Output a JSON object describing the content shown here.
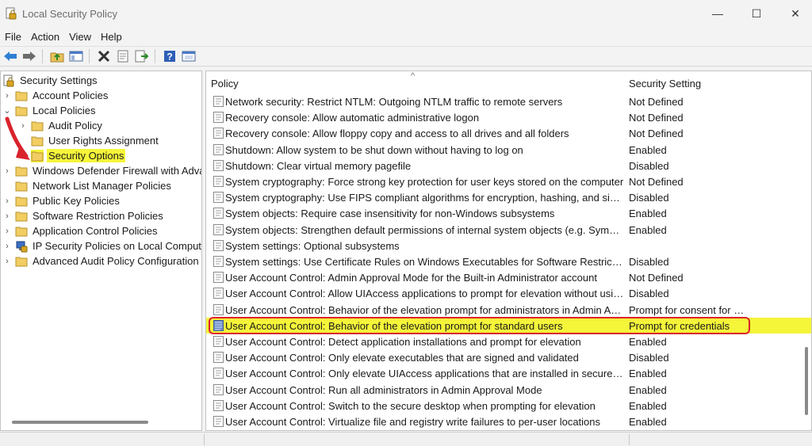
{
  "window": {
    "title": "Local Security Policy",
    "controls": {
      "minimize": "—",
      "maximize": "☐",
      "close": "✕"
    }
  },
  "menu": [
    "File",
    "Action",
    "View",
    "Help"
  ],
  "toolbar": {
    "buttons": [
      "back-icon",
      "forward-icon",
      "up-folder-icon",
      "show-hide-tree-icon",
      "delete-icon",
      "properties-icon",
      "export-list-icon",
      "help-icon",
      "console-icon"
    ]
  },
  "tree": {
    "items": [
      {
        "label": "Security Settings",
        "icon": "security-settings-icon",
        "expander": ""
      },
      {
        "label": "Account Policies",
        "icon": "folder-icon",
        "expander": "›"
      },
      {
        "label": "Local Policies",
        "icon": "folder-icon",
        "expander": "⌄"
      },
      {
        "label": "Audit Policy",
        "icon": "folder-icon",
        "expander": "›"
      },
      {
        "label": "User Rights Assignment",
        "icon": "folder-icon",
        "expander": ""
      },
      {
        "label": "Security Options",
        "icon": "folder-icon",
        "expander": "",
        "selected": true
      },
      {
        "label": "Windows Defender Firewall with Advan",
        "icon": "folder-icon",
        "expander": "›"
      },
      {
        "label": "Network List Manager Policies",
        "icon": "folder-icon",
        "expander": ""
      },
      {
        "label": "Public Key Policies",
        "icon": "folder-icon",
        "expander": "›"
      },
      {
        "label": "Software Restriction Policies",
        "icon": "folder-icon",
        "expander": "›"
      },
      {
        "label": "Application Control Policies",
        "icon": "folder-icon",
        "expander": "›"
      },
      {
        "label": "IP Security Policies on Local Computer",
        "icon": "ip-security-icon",
        "expander": "›"
      },
      {
        "label": "Advanced Audit Policy Configuration",
        "icon": "folder-icon",
        "expander": "›"
      }
    ]
  },
  "list": {
    "columns": {
      "policy": "Policy",
      "setting": "Security Setting"
    },
    "sort_indicator": "^",
    "rows": [
      {
        "policy": "Network security: Restrict NTLM: Outgoing NTLM traffic to remote servers",
        "setting": "Not Defined"
      },
      {
        "policy": "Recovery console: Allow automatic administrative logon",
        "setting": "Not Defined"
      },
      {
        "policy": "Recovery console: Allow floppy copy and access to all drives and all folders",
        "setting": "Not Defined"
      },
      {
        "policy": "Shutdown: Allow system to be shut down without having to log on",
        "setting": "Enabled"
      },
      {
        "policy": "Shutdown: Clear virtual memory pagefile",
        "setting": "Disabled"
      },
      {
        "policy": "System cryptography: Force strong key protection for user keys stored on the computer",
        "setting": "Not Defined"
      },
      {
        "policy": "System cryptography: Use FIPS compliant algorithms for encryption, hashing, and signing",
        "setting": "Disabled"
      },
      {
        "policy": "System objects: Require case insensitivity for non-Windows subsystems",
        "setting": "Enabled"
      },
      {
        "policy": "System objects: Strengthen default permissions of internal system objects (e.g. Symbolic L...",
        "setting": "Enabled"
      },
      {
        "policy": "System settings: Optional subsystems",
        "setting": ""
      },
      {
        "policy": "System settings: Use Certificate Rules on Windows Executables for Software Restriction Po...",
        "setting": "Disabled"
      },
      {
        "policy": "User Account Control: Admin Approval Mode for the Built-in Administrator account",
        "setting": "Not Defined"
      },
      {
        "policy": "User Account Control: Allow UIAccess applications to prompt for elevation without using t...",
        "setting": "Disabled"
      },
      {
        "policy": "User Account Control: Behavior of the elevation prompt for administrators in Admin Appr...",
        "setting": "Prompt for consent for n..."
      },
      {
        "policy": "User Account Control: Behavior of the elevation prompt for standard users",
        "setting": "Prompt for credentials",
        "highlighted": true
      },
      {
        "policy": "User Account Control: Detect application installations and prompt for elevation",
        "setting": "Enabled"
      },
      {
        "policy": "User Account Control: Only elevate executables that are signed and validated",
        "setting": "Disabled"
      },
      {
        "policy": "User Account Control: Only elevate UIAccess applications that are installed in secure locati...",
        "setting": "Enabled"
      },
      {
        "policy": "User Account Control: Run all administrators in Admin Approval Mode",
        "setting": "Enabled"
      },
      {
        "policy": "User Account Control: Switch to the secure desktop when prompting for elevation",
        "setting": "Enabled"
      },
      {
        "policy": "User Account Control: Virtualize file and registry write failures to per-user locations",
        "setting": "Enabled"
      }
    ]
  },
  "colors": {
    "highlight": "#f5f53a",
    "annotation": "#d9232d"
  }
}
